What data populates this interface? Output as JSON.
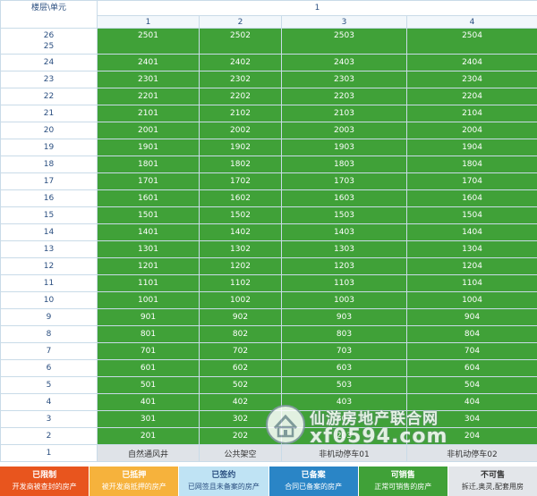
{
  "header": {
    "corner_label": "楼层\\单元",
    "block_label": "1",
    "units": [
      "1",
      "2",
      "3",
      "4"
    ]
  },
  "rows": [
    {
      "floor": "26",
      "floor_b": "25",
      "rooms": [
        "2501",
        "2502",
        "2503",
        "2504"
      ]
    },
    {
      "floor": "24",
      "rooms": [
        "2401",
        "2402",
        "2403",
        "2404"
      ]
    },
    {
      "floor": "23",
      "rooms": [
        "2301",
        "2302",
        "2303",
        "2304"
      ]
    },
    {
      "floor": "22",
      "rooms": [
        "2201",
        "2202",
        "2203",
        "2204"
      ]
    },
    {
      "floor": "21",
      "rooms": [
        "2101",
        "2102",
        "2103",
        "2104"
      ]
    },
    {
      "floor": "20",
      "rooms": [
        "2001",
        "2002",
        "2003",
        "2004"
      ]
    },
    {
      "floor": "19",
      "rooms": [
        "1901",
        "1902",
        "1903",
        "1904"
      ]
    },
    {
      "floor": "18",
      "rooms": [
        "1801",
        "1802",
        "1803",
        "1804"
      ]
    },
    {
      "floor": "17",
      "rooms": [
        "1701",
        "1702",
        "1703",
        "1704"
      ]
    },
    {
      "floor": "16",
      "rooms": [
        "1601",
        "1602",
        "1603",
        "1604"
      ]
    },
    {
      "floor": "15",
      "rooms": [
        "1501",
        "1502",
        "1503",
        "1504"
      ]
    },
    {
      "floor": "14",
      "rooms": [
        "1401",
        "1402",
        "1403",
        "1404"
      ]
    },
    {
      "floor": "13",
      "rooms": [
        "1301",
        "1302",
        "1303",
        "1304"
      ]
    },
    {
      "floor": "12",
      "rooms": [
        "1201",
        "1202",
        "1203",
        "1204"
      ]
    },
    {
      "floor": "11",
      "rooms": [
        "1101",
        "1102",
        "1103",
        "1104"
      ]
    },
    {
      "floor": "10",
      "rooms": [
        "1001",
        "1002",
        "1003",
        "1004"
      ]
    },
    {
      "floor": "9",
      "rooms": [
        "901",
        "902",
        "903",
        "904"
      ]
    },
    {
      "floor": "8",
      "rooms": [
        "801",
        "802",
        "803",
        "804"
      ]
    },
    {
      "floor": "7",
      "rooms": [
        "701",
        "702",
        "703",
        "704"
      ]
    },
    {
      "floor": "6",
      "rooms": [
        "601",
        "602",
        "603",
        "604"
      ]
    },
    {
      "floor": "5",
      "rooms": [
        "501",
        "502",
        "503",
        "504"
      ]
    },
    {
      "floor": "4",
      "rooms": [
        "401",
        "402",
        "403",
        "404"
      ]
    },
    {
      "floor": "3",
      "rooms": [
        "301",
        "302",
        "303",
        "304"
      ]
    },
    {
      "floor": "2",
      "rooms": [
        "201",
        "202",
        "203",
        "204"
      ]
    },
    {
      "floor": "1",
      "rooms": [
        "自然通风井",
        "公共架空",
        "非机动停车01",
        "非机动停车02"
      ]
    }
  ],
  "legend": [
    {
      "title": "已限制",
      "desc": "开发商被查封的房产",
      "bg": "#e8551e",
      "color": "#ffffff"
    },
    {
      "title": "已抵押",
      "desc": "被开发商抵押的房产",
      "bg": "#f6b23c",
      "color": "#ffffff"
    },
    {
      "title": "已签约",
      "desc": "已网签且未备案的房产",
      "bg": "#bfe3f4",
      "color": "#2b4f80"
    },
    {
      "title": "已备案",
      "desc": "合同已备案的房产",
      "bg": "#2a85c6",
      "color": "#ffffff"
    },
    {
      "title": "可销售",
      "desc": "正常可销售的房产",
      "bg": "#40a138",
      "color": "#ffffff"
    },
    {
      "title": "不可售",
      "desc": "拆迁,奥灵,配套用房",
      "bg": "#e3e6ea",
      "color": "#333333"
    }
  ],
  "colors": {
    "available": "#40a138",
    "not_for_sale": "#dfe3e8",
    "grid_line": "#c9dbe8",
    "header_text": "#2b4f80"
  },
  "watermark": {
    "title": "仙游房地产联合网",
    "url": "xf0594.com"
  }
}
